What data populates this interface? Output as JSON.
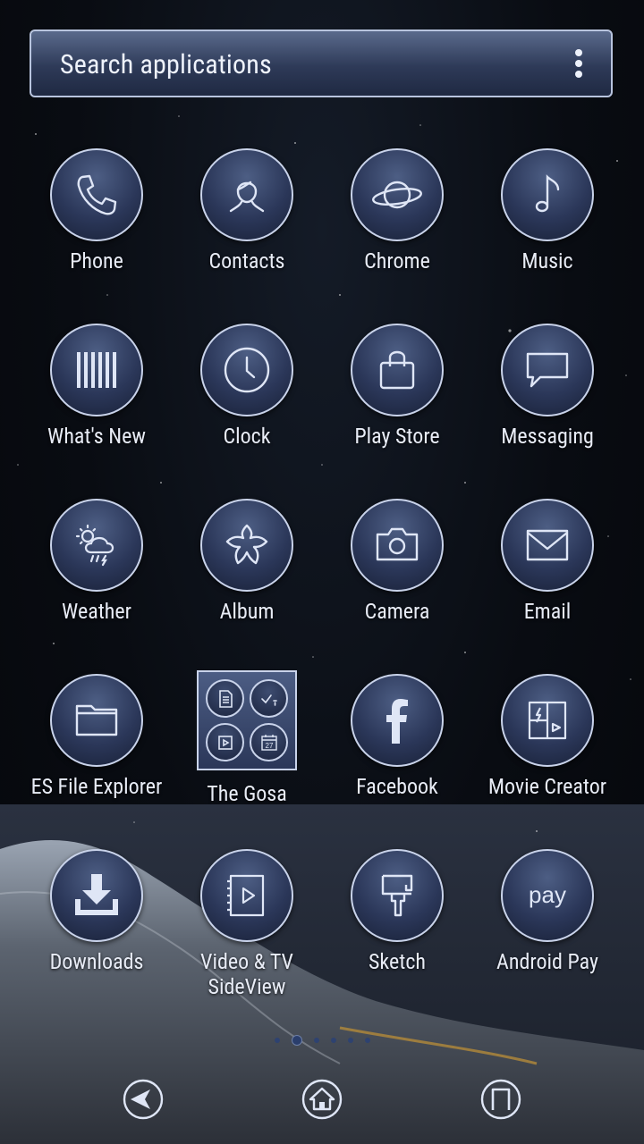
{
  "search": {
    "placeholder": "Search applications",
    "menu_icon": "overflow-menu-icon"
  },
  "apps": [
    {
      "label": "Phone",
      "icon": "phone-icon"
    },
    {
      "label": "Contacts",
      "icon": "contacts-icon"
    },
    {
      "label": "Chrome",
      "icon": "planet-icon"
    },
    {
      "label": "Music",
      "icon": "music-note-icon"
    },
    {
      "label": "What's New",
      "icon": "barcode-icon"
    },
    {
      "label": "Clock",
      "icon": "clock-icon"
    },
    {
      "label": "Play Store",
      "icon": "shopping-bag-icon"
    },
    {
      "label": "Messaging",
      "icon": "chat-bubble-icon"
    },
    {
      "label": "Weather",
      "icon": "weather-icon"
    },
    {
      "label": "Album",
      "icon": "flower-icon"
    },
    {
      "label": "Camera",
      "icon": "camera-icon"
    },
    {
      "label": "Email",
      "icon": "envelope-icon"
    },
    {
      "label": "ES File Explorer",
      "icon": "folder-icon"
    },
    {
      "label": "The Gosa",
      "icon": "app-folder-icon"
    },
    {
      "label": "Facebook",
      "icon": "facebook-icon"
    },
    {
      "label": "Movie Creator",
      "icon": "movie-creator-icon"
    },
    {
      "label": "Downloads",
      "icon": "download-icon"
    },
    {
      "label": "Video & TV SideView",
      "icon": "video-icon"
    },
    {
      "label": "Sketch",
      "icon": "paint-brush-icon"
    },
    {
      "label": "Android Pay",
      "icon": "pay-icon",
      "icon_text": "pay"
    }
  ],
  "folder_preview": [
    {
      "icon": "document-icon"
    },
    {
      "icon": "checklist-icon"
    },
    {
      "icon": "play-icon"
    },
    {
      "icon": "calendar-icon",
      "icon_text": "27"
    }
  ],
  "pagination": {
    "page_count": 6,
    "current_page": 2
  },
  "navbar": {
    "back": "back-icon",
    "home": "home-icon",
    "recents": "recents-icon"
  },
  "colors": {
    "icon_stroke": "#dfe6f6",
    "icon_fill": "#2b3759",
    "accent": "#c9d3ea"
  }
}
